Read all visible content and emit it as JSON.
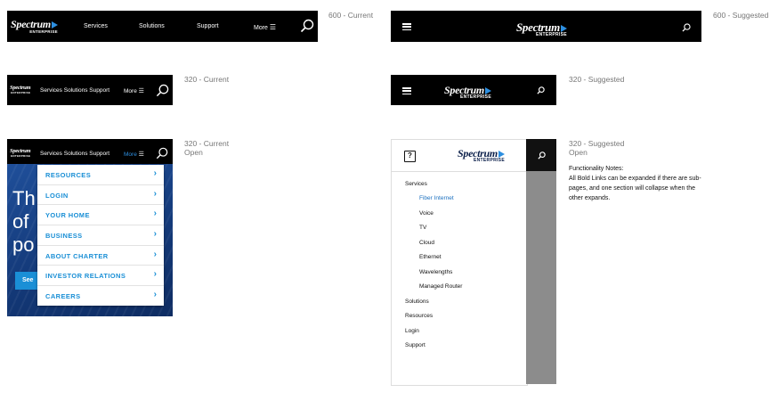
{
  "brand": {
    "name": "Spectrum",
    "sub": "ENTERPRISE"
  },
  "labels": {
    "l600_current": "600 - Current",
    "l600_suggested": "600 - Suggested",
    "l320_current": "320 - Current",
    "l320_suggested": "320 - Suggested",
    "l320_current_open_1": "320 - Current",
    "l320_current_open_2": "Open",
    "l320_suggested_open_1": "320 - Suggested",
    "l320_suggested_open_2": "Open"
  },
  "nav600": {
    "services": "Services",
    "solutions": "Solutions",
    "support": "Support",
    "more": "More"
  },
  "nav320": {
    "links": "Services Solutions Support",
    "more": "More"
  },
  "dropdown": [
    "RESOURCES",
    "LOGIN",
    "YOUR HOME",
    "BUSINESS",
    "ABOUT CHARTER",
    "INVESTOR RELATIONS",
    "CAREERS"
  ],
  "promo": {
    "l1": "Th",
    "l2": "of",
    "l3": "po",
    "button": "See"
  },
  "suggested_menu": {
    "help": "?",
    "services": "Services",
    "sub": [
      "Fiber Internet",
      "Voice",
      "TV",
      "Cloud",
      "Ethernet",
      "Wavelengths",
      "Managed Router"
    ],
    "others": [
      "Solutions",
      "Resources",
      "Login",
      "Support"
    ]
  },
  "notes": {
    "title": "Functionality Notes:",
    "l1": "All Bold Links can be expanded if there are sub-",
    "l2": "pages, and one section will collapse when the",
    "l3": "other expands."
  },
  "colors": {
    "bar": "#000000",
    "accent": "#1a8fd6",
    "triangle": "#2d8fe0"
  }
}
